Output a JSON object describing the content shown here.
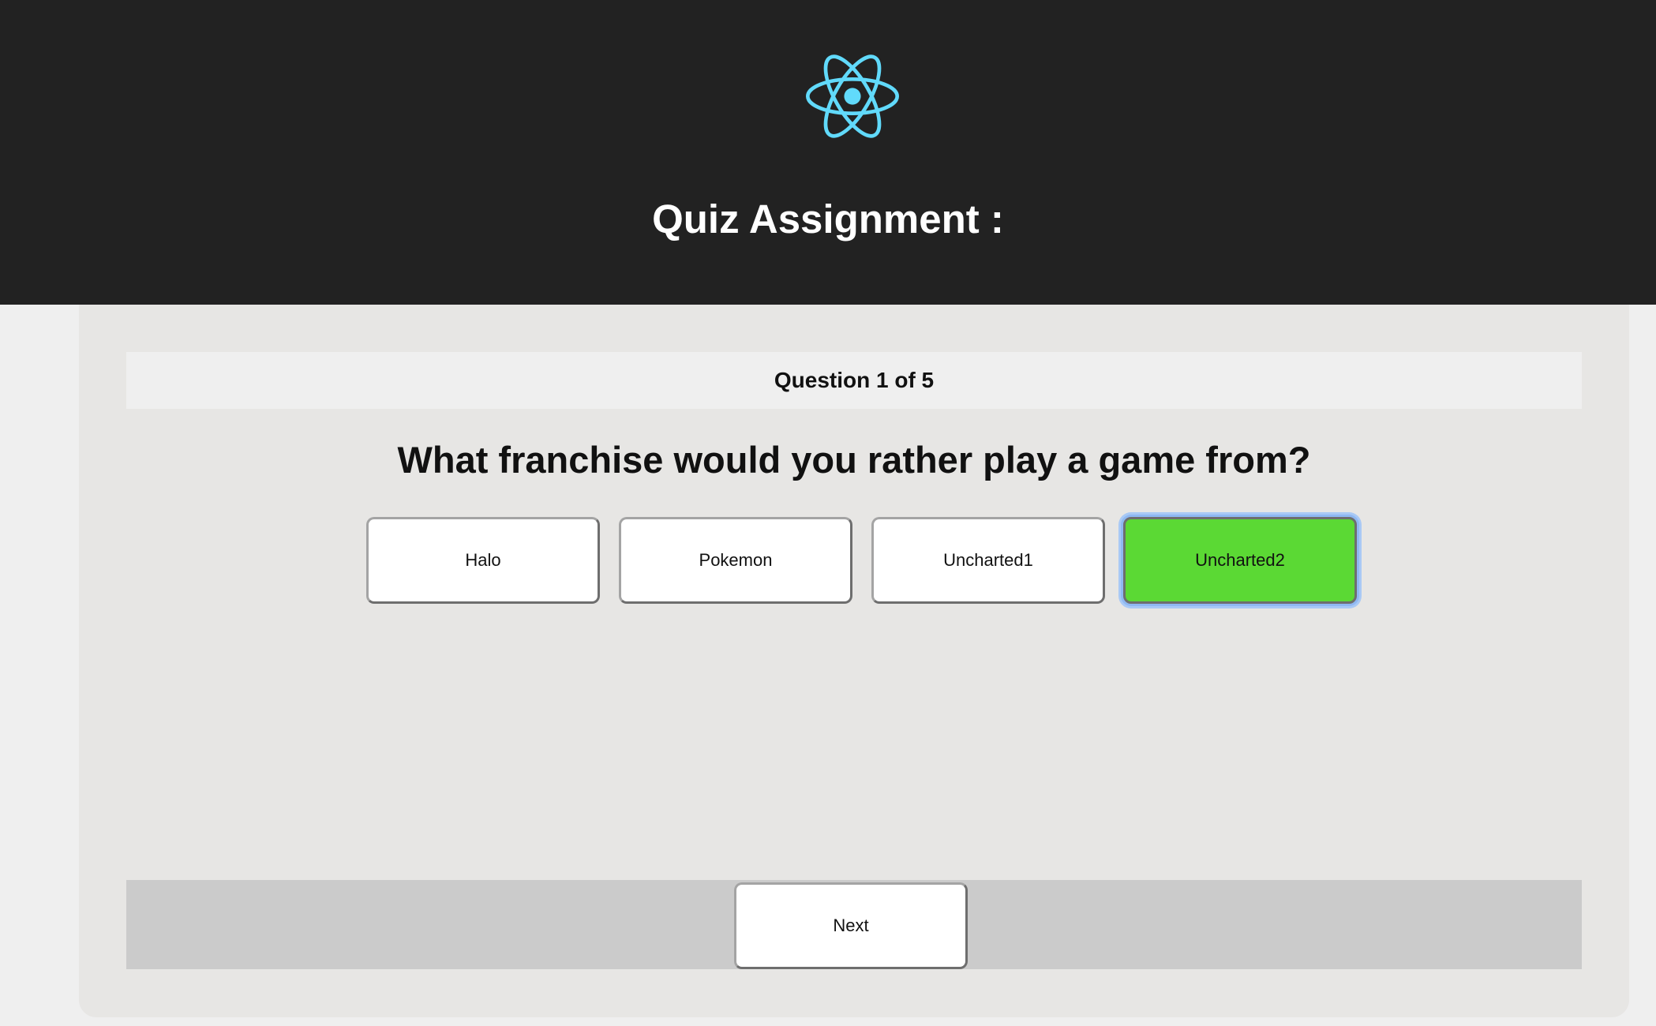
{
  "header": {
    "title": "Quiz Assignment :",
    "logo_icon": "react-atom-icon",
    "logo_color": "#61dafb",
    "background": "#222222"
  },
  "quiz": {
    "counter": "Question 1 of 5",
    "question": "What franchise would you rather play a game from?",
    "answers": [
      {
        "label": "Halo",
        "selected": false
      },
      {
        "label": "Pokemon",
        "selected": false
      },
      {
        "label": "Uncharted1",
        "selected": false
      },
      {
        "label": "Uncharted2",
        "selected": true
      }
    ],
    "selected_color": "#5bd934"
  },
  "footer": {
    "next_label": "Next"
  }
}
